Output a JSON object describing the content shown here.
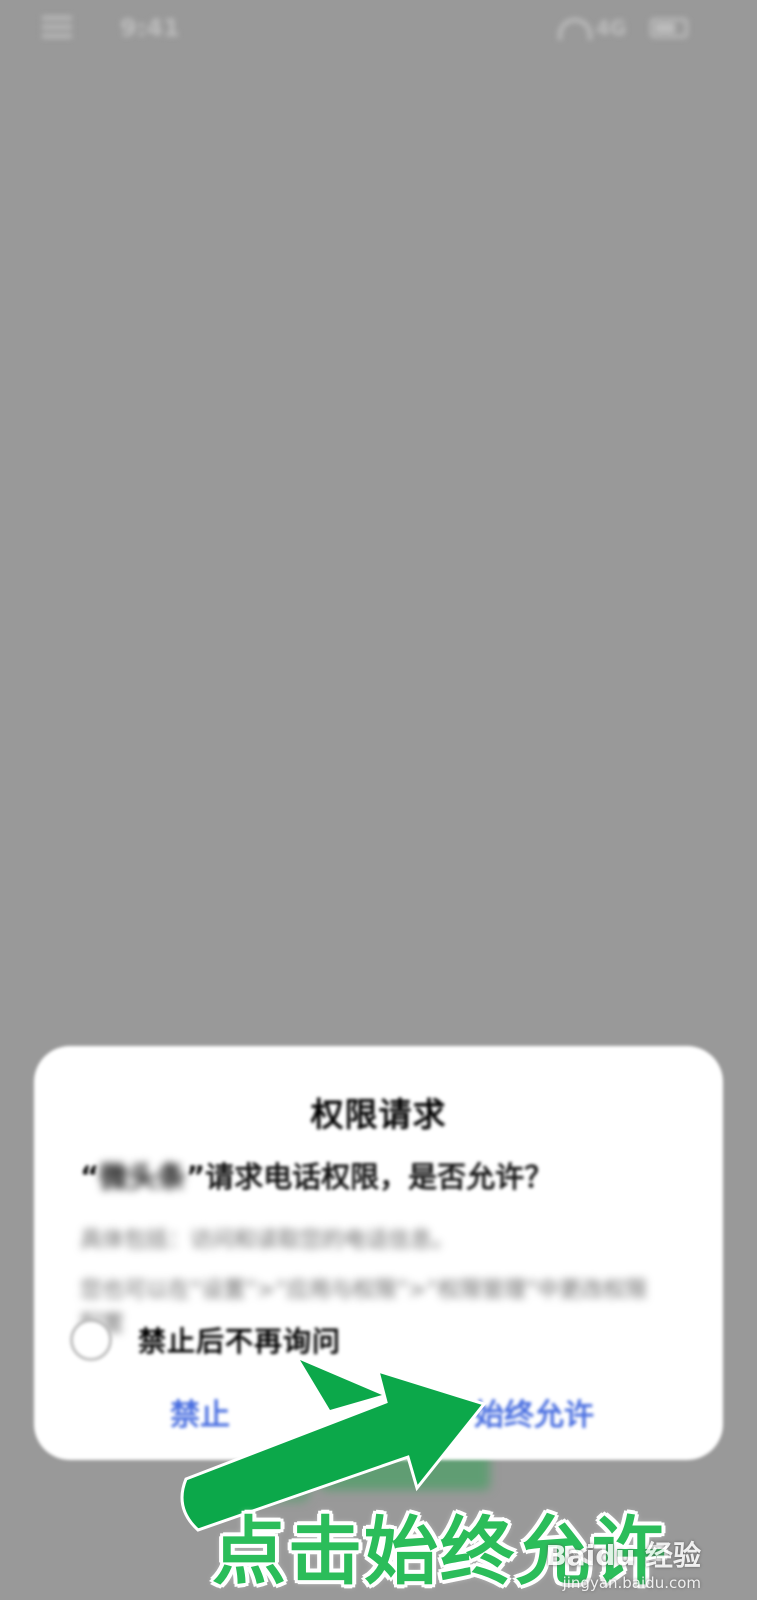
{
  "status_bar": {
    "time": "9:41",
    "signal": "4G"
  },
  "dialog": {
    "title": "权限请求",
    "message_prefix": "“",
    "app_name": "微头条",
    "message_suffix": "”请求电话权限，是否允许？",
    "detail_1": "具体包括：访问和读取您的电话信息。",
    "detail_2": "您也可以在“设置”>“应用与权限”>“权限管理”中更改权限配置",
    "checkbox_label": "禁止后不再询问",
    "deny_label": "禁止",
    "allow_label": "始终允许"
  },
  "annotation": {
    "text": "点击始终允许",
    "arrow_color": "#0ca84a"
  },
  "watermark": {
    "logo": "Baidu 经验",
    "url": "jingyan.baidu.com"
  },
  "colors": {
    "background_overlay": "#999999",
    "button_blue": "#4a6fe0",
    "annotation_green": "#2bbd5a"
  }
}
